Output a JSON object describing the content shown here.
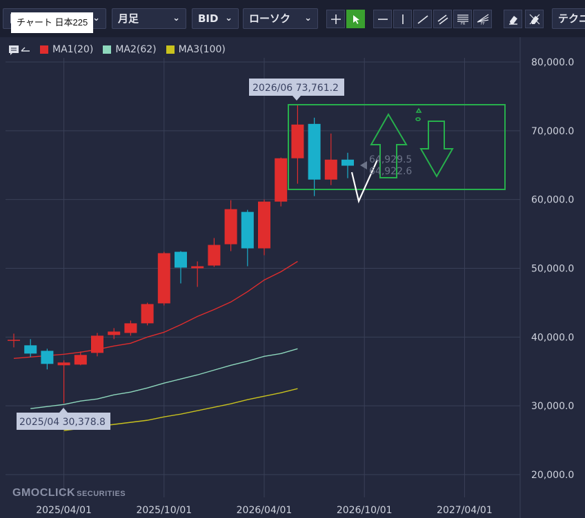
{
  "toolbar": {
    "symbol_tooltip": "チャート 日本225",
    "symbol_prefix": "日",
    "period": "月足",
    "price_type": "BID",
    "chart_style": "ローソク",
    "tech_label": "テクニ",
    "tool_icons": [
      "crosshair-icon",
      "cursor-icon",
      "horizontal-line-icon",
      "vertical-line-icon",
      "trend-line-icon",
      "parallel-channel-icon",
      "fibonacci-retracement-icon",
      "fibonacci-fan-icon",
      "eraser-icon",
      "clear-all-icon"
    ]
  },
  "legend": {
    "toggle_icon": "chat-icon",
    "items": [
      {
        "label": "MA1(20)",
        "color": "#e02d2d"
      },
      {
        "label": "MA2(62)",
        "color": "#8ed8bd"
      },
      {
        "label": "MA3(100)",
        "color": "#c9c21e"
      }
    ]
  },
  "annotations": {
    "high": "2026/06 73,761.2",
    "low": "2025/04 30,378.8",
    "last_top": "64,929.5",
    "last_bottom": "64,922.6"
  },
  "watermark": {
    "brand": "GMOCLICK",
    "sub": "SECURITIES"
  },
  "colors": {
    "up": "#e02d2d",
    "down": "#1ab0cc",
    "box": "#27b04c",
    "arrows": "#27b04c",
    "grid": "#3a4058"
  },
  "chart_data": {
    "type": "candlestick",
    "ylim": [
      20000,
      80000
    ],
    "y_ticks": [
      20000,
      30000,
      40000,
      50000,
      60000,
      70000,
      80000
    ],
    "y_tick_labels": [
      "20,000.0",
      "30,000.0",
      "40,000.0",
      "50,000.0",
      "60,000.0",
      "70,000.0",
      "80,000.0"
    ],
    "x_ticks": [
      "2025/04/01",
      "2025/10/01",
      "2026/04/01",
      "2026/10/01",
      "2027/04/01"
    ],
    "x_tick_index": [
      3,
      9,
      15,
      21,
      27
    ],
    "candles": [
      {
        "o": 39500,
        "h": 40500,
        "l": 38500,
        "c": 39600
      },
      {
        "o": 38800,
        "h": 39700,
        "l": 37100,
        "c": 37600
      },
      {
        "o": 38000,
        "h": 38300,
        "l": 35300,
        "c": 36100
      },
      {
        "o": 35900,
        "h": 36600,
        "l": 30378.8,
        "c": 36300
      },
      {
        "o": 36000,
        "h": 37900,
        "l": 35900,
        "c": 37400
      },
      {
        "o": 37700,
        "h": 40600,
        "l": 37200,
        "c": 40200
      },
      {
        "o": 40300,
        "h": 41300,
        "l": 39700,
        "c": 40800
      },
      {
        "o": 40600,
        "h": 42400,
        "l": 40200,
        "c": 42000
      },
      {
        "o": 42000,
        "h": 45000,
        "l": 41700,
        "c": 44800
      },
      {
        "o": 44900,
        "h": 52400,
        "l": 44600,
        "c": 52200
      },
      {
        "o": 52400,
        "h": 52500,
        "l": 47800,
        "c": 50100
      },
      {
        "o": 50000,
        "h": 51000,
        "l": 47300,
        "c": 50300
      },
      {
        "o": 50400,
        "h": 54400,
        "l": 50200,
        "c": 53400
      },
      {
        "o": 53500,
        "h": 59900,
        "l": 52500,
        "c": 58600
      },
      {
        "o": 58200,
        "h": 58500,
        "l": 50300,
        "c": 52900
      },
      {
        "o": 52900,
        "h": 60000,
        "l": 51900,
        "c": 59700
      },
      {
        "o": 59700,
        "h": 66100,
        "l": 59000,
        "c": 66000
      },
      {
        "o": 66000,
        "h": 73761.2,
        "l": 62300,
        "c": 70900
      },
      {
        "o": 71000,
        "h": 71900,
        "l": 60500,
        "c": 62900
      },
      {
        "o": 62900,
        "h": 69600,
        "l": 62100,
        "c": 65800
      },
      {
        "o": 65800,
        "h": 66800,
        "l": 63100,
        "c": 64922.6
      }
    ],
    "series": [
      {
        "name": "MA1(20)",
        "color": "#e02d2d",
        "values": [
          36900,
          37100,
          37300,
          37500,
          37800,
          38200,
          38700,
          39100,
          40000,
          40700,
          41800,
          43000,
          44000,
          45100,
          46600,
          48300,
          49500,
          51000
        ]
      },
      {
        "name": "MA2(62)",
        "color": "#8ed8bd",
        "values": [
          29600,
          29900,
          30200,
          30700,
          31000,
          31600,
          32000,
          32600,
          33300,
          33900,
          34500,
          35200,
          35900,
          36500,
          37200,
          37600,
          38300
        ]
      },
      {
        "name": "MA3(100)",
        "color": "#c9c21e",
        "values": [
          26400,
          26700,
          27000,
          27300,
          27600,
          27900,
          28400,
          28800,
          29300,
          29800,
          30300,
          30900,
          31400,
          31900,
          32500
        ]
      }
    ],
    "ma_start_index": [
      0,
      1,
      3
    ]
  }
}
